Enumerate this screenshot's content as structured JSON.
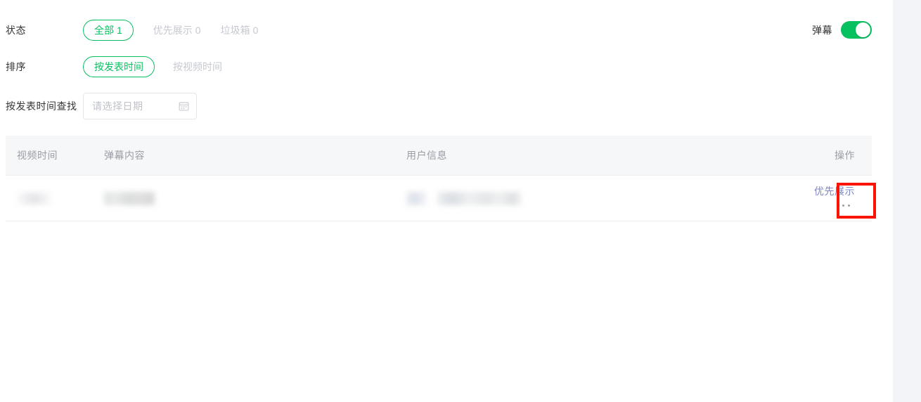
{
  "filters": {
    "status": {
      "label": "状态",
      "active_tab": {
        "label": "全部",
        "count": "1"
      },
      "tabs": [
        {
          "label": "优先展示",
          "count": "0"
        },
        {
          "label": "垃圾箱",
          "count": "0"
        }
      ]
    },
    "sort": {
      "label": "排序",
      "active_tab": {
        "label": "按发表时间"
      },
      "tabs": [
        {
          "label": "按视频时间"
        }
      ]
    },
    "date": {
      "label": "按发表时间查找",
      "placeholder": "请选择日期",
      "value": "",
      "icon": "calendar-icon"
    }
  },
  "danmu_toggle": {
    "label": "弹幕",
    "state": "on",
    "color": "#07c160"
  },
  "table": {
    "columns": [
      {
        "key": "video_time",
        "label": "视频时间"
      },
      {
        "key": "danmu_content",
        "label": "弹幕内容"
      },
      {
        "key": "user_info",
        "label": "用户信息"
      },
      {
        "key": "action",
        "label": "操作"
      }
    ],
    "rows": [
      {
        "video_time": "",
        "danmu_content": "",
        "user_info": "",
        "action_link": "优先展示",
        "more_icon": "ellipsis-icon"
      }
    ]
  },
  "annotation": {
    "type": "highlight-box",
    "color": "#fa1400",
    "target": "row-more-button"
  },
  "colors": {
    "accent_green": "#07c160",
    "header_bg": "#f6f7f9",
    "link_blue": "#7d87c8",
    "muted_text": "#9a9da4",
    "inactive_tab": "#c6c9d0",
    "page_bg": "#f2f4f7"
  }
}
